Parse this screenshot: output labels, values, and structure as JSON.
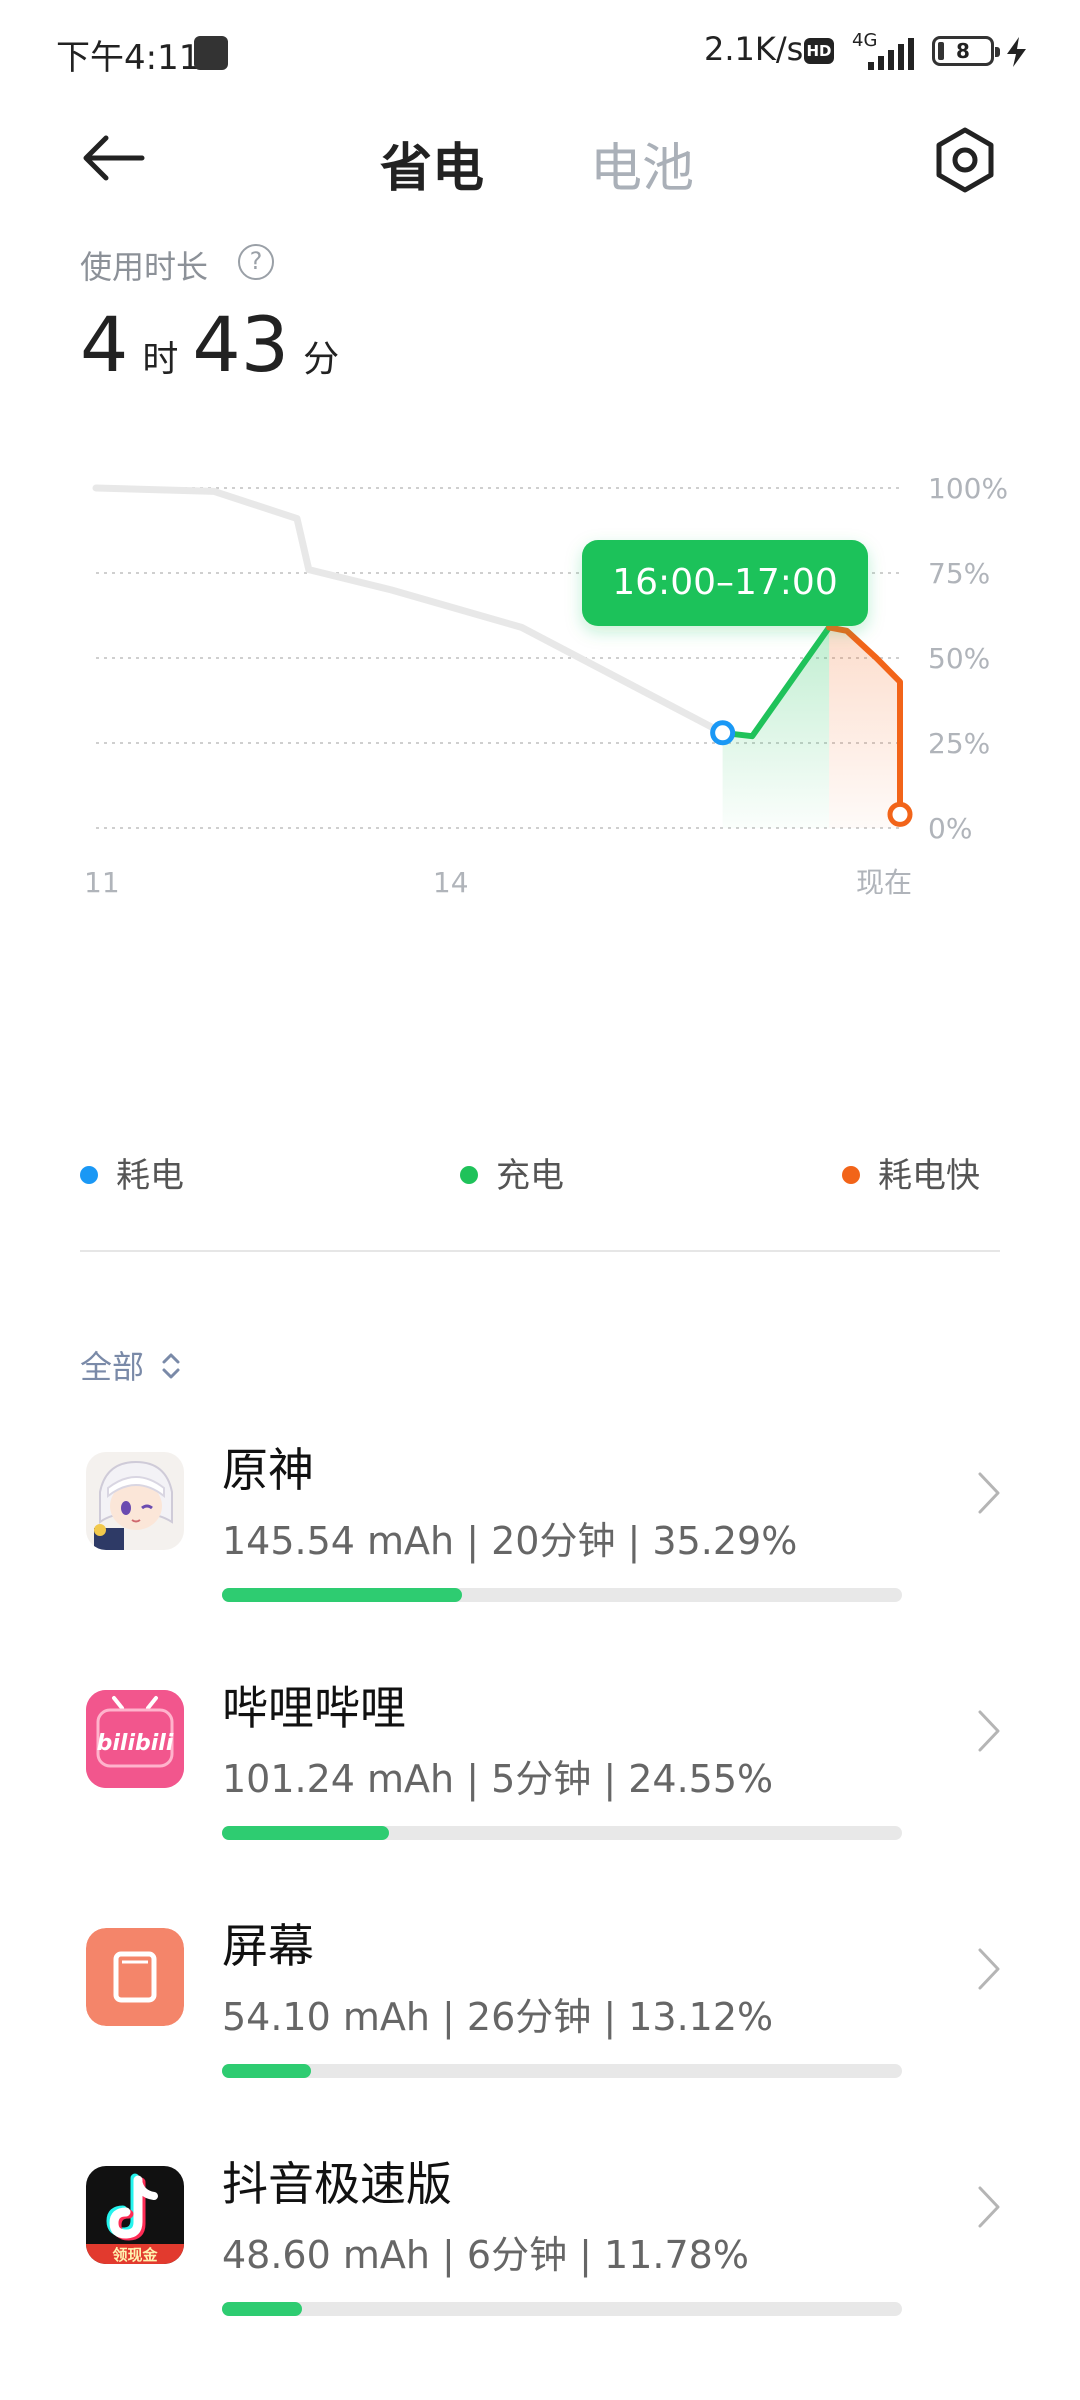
{
  "status_bar": {
    "time": "下午4:11",
    "net_speed": "2.1K/s",
    "hd_badge": "HD",
    "network": "4G",
    "battery_level": "8"
  },
  "header": {
    "tab_active": "省电",
    "tab_inactive": "电池"
  },
  "usage": {
    "label": "使用时长",
    "help_glyph": "?",
    "hours": "4",
    "hours_unit": "时",
    "minutes": "43",
    "minutes_unit": "分"
  },
  "chart_data": {
    "type": "line",
    "x_ticks": [
      "11",
      "14",
      "现在"
    ],
    "y_ticks": [
      "100%",
      "75%",
      "50%",
      "25%",
      "0%"
    ],
    "ylim": [
      0,
      100
    ],
    "tooltip": "16:00–17:00",
    "series": [
      {
        "name": "耗电",
        "color": "#e8e8e8",
        "points": [
          [
            11.0,
            100
          ],
          [
            12.0,
            99
          ],
          [
            12.7,
            91
          ],
          [
            12.8,
            76
          ],
          [
            13.5,
            70
          ],
          [
            14.6,
            59
          ],
          [
            16.3,
            28
          ]
        ]
      },
      {
        "name": "充电",
        "color": "#1fc25a",
        "points": [
          [
            16.3,
            28
          ],
          [
            16.55,
            27
          ],
          [
            17.2,
            59
          ]
        ]
      },
      {
        "name": "耗电快",
        "color": "#f26419",
        "points": [
          [
            17.2,
            59
          ],
          [
            17.35,
            58
          ],
          [
            17.6,
            50
          ],
          [
            17.8,
            43
          ],
          [
            17.8,
            4
          ]
        ]
      }
    ],
    "legend": [
      {
        "label": "耗电",
        "color": "#1a98f5"
      },
      {
        "label": "充电",
        "color": "#1fc25a"
      },
      {
        "label": "耗电快",
        "color": "#f26419"
      }
    ],
    "grid": true
  },
  "filter": {
    "label": "全部"
  },
  "apps": [
    {
      "name": "原神",
      "stats": "145.54 mAh | 20分钟 | 35.29%",
      "percent": 35.29
    },
    {
      "name": "哔哩哔哩",
      "icon_text": "bilibili",
      "stats": "101.24 mAh | 5分钟 | 24.55%",
      "percent": 24.55
    },
    {
      "name": "屏幕",
      "stats": "54.10 mAh | 26分钟 | 13.12%",
      "percent": 13.12
    },
    {
      "name": "抖音极速版",
      "icon_text": "领现金",
      "stats": "48.60 mAh | 6分钟 | 11.78%",
      "percent": 11.78
    }
  ]
}
